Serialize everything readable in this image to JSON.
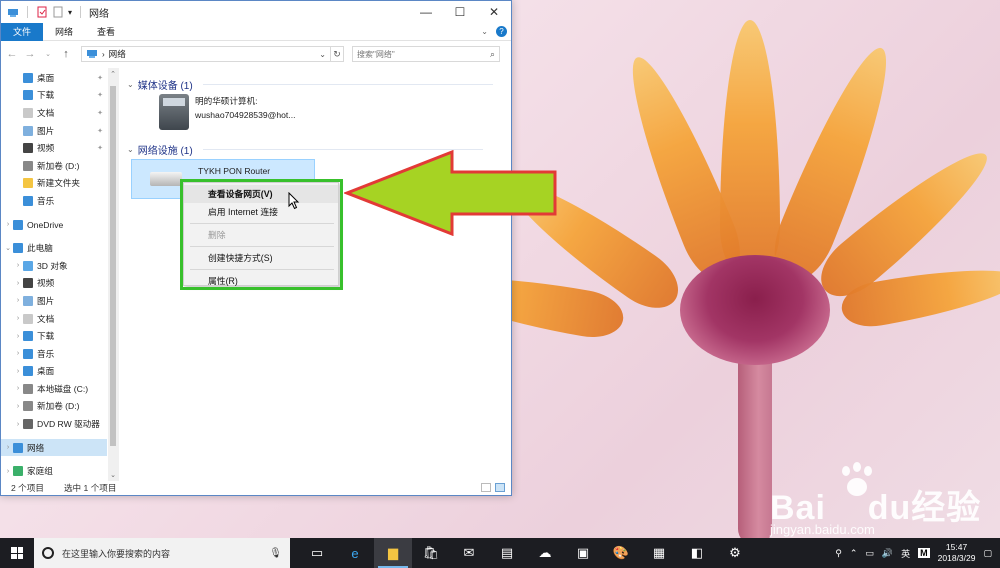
{
  "window": {
    "title": "网络",
    "ribbon_tabs": [
      "文件",
      "网络",
      "查看"
    ],
    "address": "网络",
    "search_placeholder": "搜索\"网络\""
  },
  "nav": {
    "quick_access": [
      {
        "label": "桌面",
        "pinned": true
      },
      {
        "label": "下载",
        "pinned": true
      },
      {
        "label": "文档",
        "pinned": true
      },
      {
        "label": "图片",
        "pinned": true
      },
      {
        "label": "视频",
        "pinned": true
      },
      {
        "label": "新加卷 (D:)",
        "pinned": false
      },
      {
        "label": "新建文件夹",
        "pinned": false
      },
      {
        "label": "音乐",
        "pinned": false
      }
    ],
    "onedrive": "OneDrive",
    "this_pc": "此电脑",
    "pc_items": [
      "3D 对象",
      "视频",
      "图片",
      "文档",
      "下载",
      "音乐",
      "桌面",
      "本地磁盘 (C:)",
      "新加卷 (D:)",
      "DVD RW 驱动器"
    ],
    "network": "网络",
    "homegroup": "家庭组"
  },
  "content": {
    "group1": "媒体设备 (1)",
    "device1": {
      "name": "明的华硕计算机:",
      "sub": "wushao704928539@hot..."
    },
    "group2": "网络设施 (1)",
    "device2": {
      "name": "TYKH PON Router"
    }
  },
  "context_menu": {
    "items": [
      "查看设备网页(V)",
      "启用 Internet 连接",
      "删除",
      "创建快捷方式(S)",
      "属性(R)"
    ]
  },
  "status": {
    "count": "2 个项目",
    "selected": "选中 1 个项目"
  },
  "taskbar": {
    "search_text": "在这里输入你要搜索的内容",
    "ime1": "英",
    "ime2": "M",
    "time": "15:47",
    "date": "2018/3/29"
  },
  "watermark": {
    "brand": "Bai",
    "brand2": "du",
    "cn": "经验",
    "url": "jingyan.baidu.com"
  },
  "colors": {
    "accent": "#1979ca",
    "highlight_box": "#38c02c",
    "arrow_fill": "#a6d323",
    "arrow_stroke": "#e23a36"
  }
}
